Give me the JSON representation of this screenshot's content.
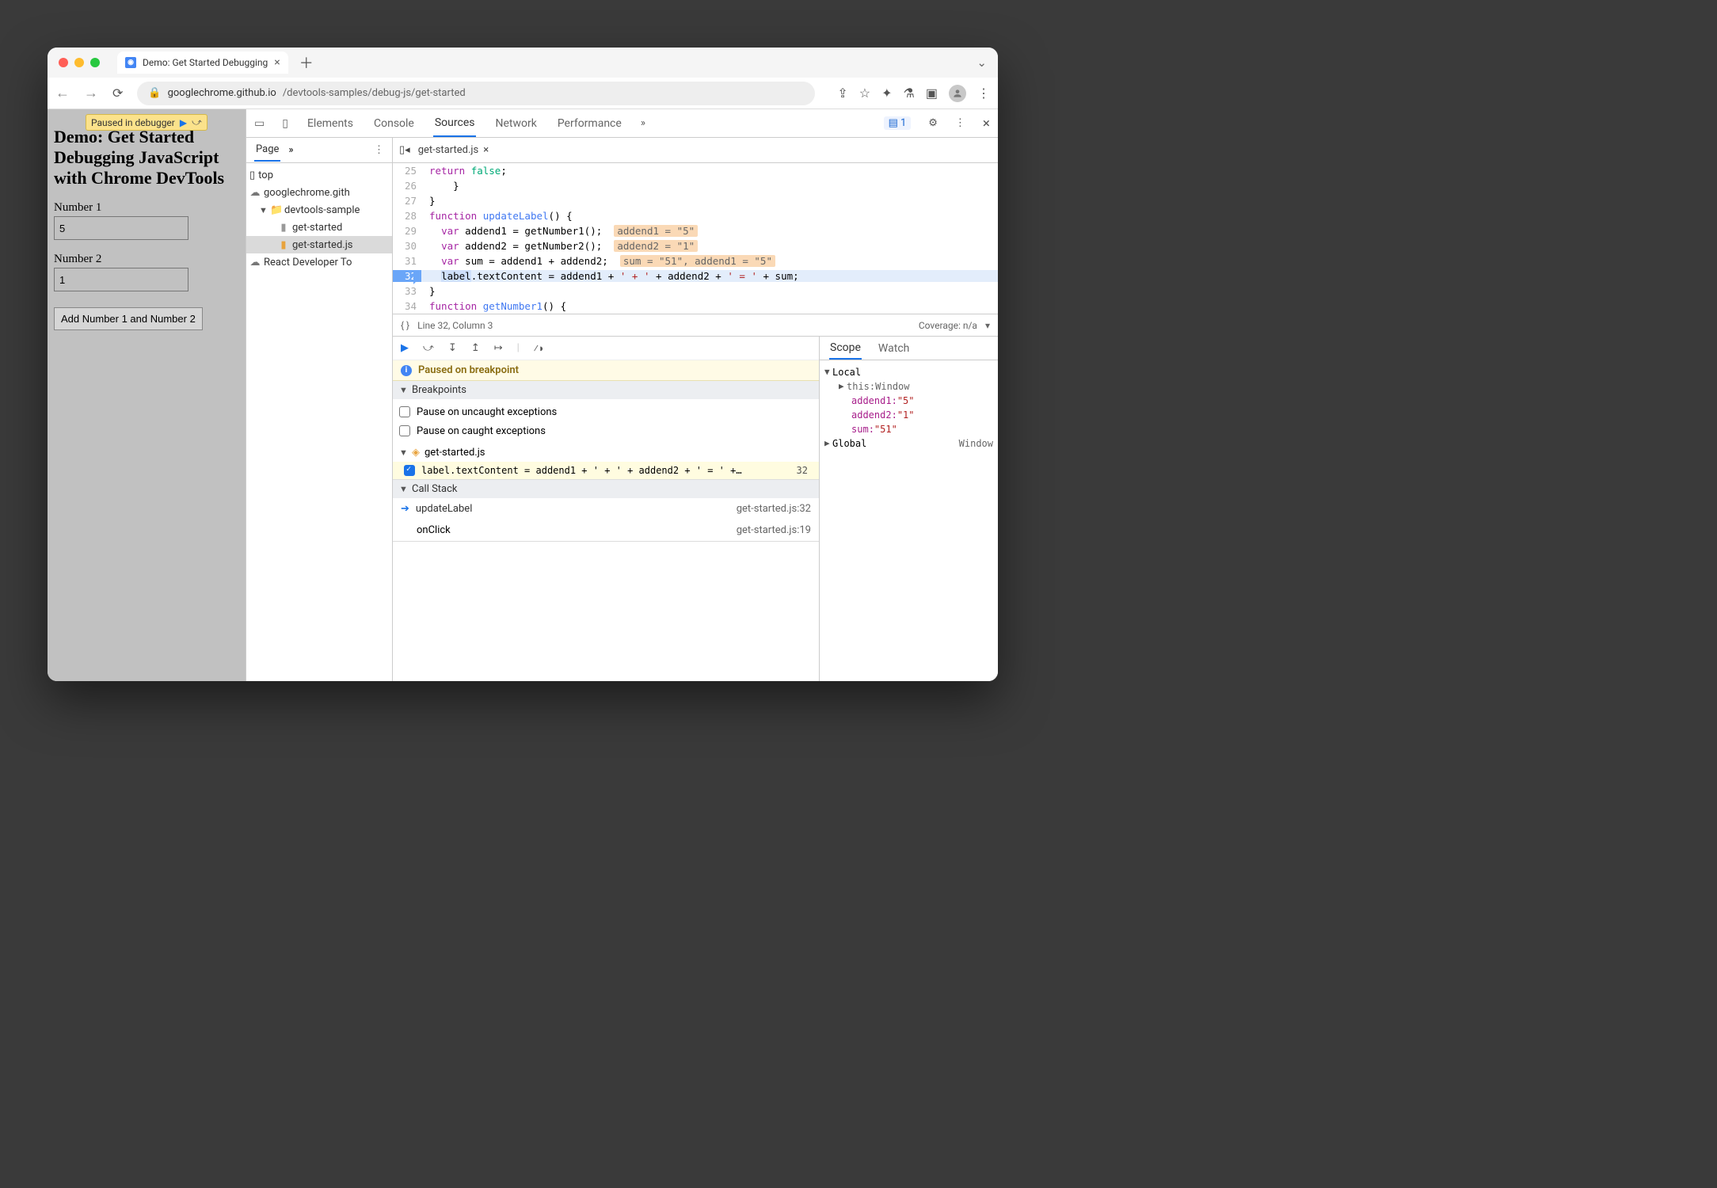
{
  "browser": {
    "tab_title": "Demo: Get Started Debugging",
    "url_host": "googlechrome.github.io",
    "url_path": "/devtools-samples/debug-js/get-started",
    "issue_count": "1"
  },
  "page": {
    "paused_badge": "Paused in debugger",
    "heading": "Demo: Get Started Debugging JavaScript with Chrome DevTools",
    "label1": "Number 1",
    "value1": "5",
    "label2": "Number 2",
    "value2": "1",
    "button": "Add Number 1 and Number 2"
  },
  "devtools": {
    "tabs": [
      "Elements",
      "Console",
      "Sources",
      "Network",
      "Performance"
    ],
    "active_tab": "Sources",
    "nav_tab": "Page",
    "tree": {
      "top": "top",
      "origin": "googlechrome.gith",
      "folder": "devtools-sample",
      "file_html": "get-started",
      "file_js": "get-started.js",
      "ext": "React Developer To"
    },
    "open_file": "get-started.js",
    "code": {
      "l25": "      return false;",
      "l26": "    }",
      "l27": "}",
      "l28_kw": "function",
      "l28_fn": "updateLabel",
      "l28_rest": "() {",
      "l29_pre": "  var addend1 = getNumber1();  ",
      "l29_anno": "addend1 = \"5\"",
      "l30_pre": "  var addend2 = getNumber2();  ",
      "l30_anno": "addend2 = \"1\"",
      "l31_pre": "  var sum = addend1 + addend2;  ",
      "l31_anno": "sum = \"51\", addend1 = \"5\"",
      "l32": "  label.textContent = addend1 + ' + ' + addend2 + ' = ' + sum;",
      "l33": "}",
      "l34_kw": "function",
      "l34_fn": "getNumber1",
      "l34_rest": "() {"
    },
    "status": {
      "pos": "Line 32, Column 3",
      "coverage": "Coverage: n/a"
    },
    "paused_msg": "Paused on breakpoint",
    "breakpoints": {
      "title": "Breakpoints",
      "opt1": "Pause on uncaught exceptions",
      "opt2": "Pause on caught exceptions",
      "file": "get-started.js",
      "line_code": "label.textContent = addend1 + ' + ' + addend2 + ' = ' +…",
      "line_no": "32"
    },
    "callstack": {
      "title": "Call Stack",
      "frames": [
        {
          "fn": "updateLabel",
          "loc": "get-started.js:32"
        },
        {
          "fn": "onClick",
          "loc": "get-started.js:19"
        }
      ]
    },
    "scope": {
      "tab1": "Scope",
      "tab2": "Watch",
      "local": "Local",
      "global": "Global",
      "window": "Window",
      "this_k": "this",
      "this_v": "Window",
      "a1_k": "addend1",
      "a1_v": "\"5\"",
      "a2_k": "addend2",
      "a2_v": "\"1\"",
      "sum_k": "sum",
      "sum_v": "\"51\""
    }
  }
}
